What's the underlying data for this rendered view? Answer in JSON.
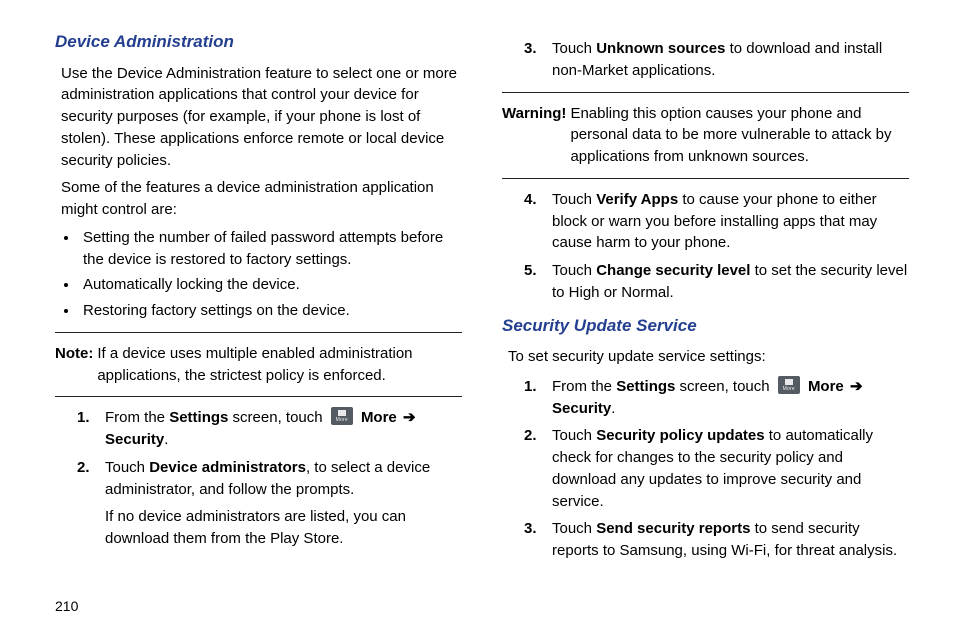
{
  "page_number": "210",
  "left": {
    "heading": "Device Administration",
    "p1": "Use the Device Administration feature to select one or more administration applications that control your device for security purposes (for example, if your phone is lost of stolen). These applications enforce remote or local device security policies.",
    "p2": "Some of the features a device administration application might control are:",
    "bullets": [
      "Setting the number of failed password attempts before the device is restored to factory settings.",
      "Automatically locking the device.",
      "Restoring factory settings on the device."
    ],
    "note_label": "Note:",
    "note_body": "If a device uses multiple enabled administration applications, the strictest policy is enforced.",
    "step1": {
      "pre": "From the ",
      "settings": "Settings",
      "mid": " screen, touch ",
      "more": "More",
      "arrow": "➔",
      "security": "Security",
      "post": "."
    },
    "step2": {
      "touch": "Touch ",
      "da": "Device administrators",
      "rest": ", to select a device administrator, and follow the prompts.",
      "sub": "If no device administrators are listed, you can download them from the Play Store."
    }
  },
  "right": {
    "step3": {
      "touch": "Touch ",
      "us": "Unknown sources",
      "rest": " to download and install non-Market applications."
    },
    "warn_label": "Warning!",
    "warn_body": "Enabling this option causes your phone and personal data to be more vulnerable to attack by applications from unknown sources.",
    "step4": {
      "touch": "Touch ",
      "va": "Verify Apps",
      "rest": " to cause your phone to either block or warn you before installing apps that may cause harm to your phone."
    },
    "step5": {
      "touch": "Touch ",
      "csl": "Change security level",
      "rest": " to set the security level to High or Normal."
    },
    "heading2": "Security Update Service",
    "p3": "To set security update service settings:",
    "b_step1": {
      "pre": "From the ",
      "settings": "Settings",
      "mid": " screen, touch ",
      "more": "More",
      "arrow": "➔",
      "security": "Security",
      "post": "."
    },
    "b_step2": {
      "touch": "Touch ",
      "spu": "Security policy updates",
      "rest": " to automatically check for changes to the security policy and download any updates to improve security and service."
    },
    "b_step3": {
      "touch": "Touch ",
      "ssr": "Send security reports",
      "rest": " to send security reports to Samsung, using Wi-Fi, for threat analysis."
    }
  }
}
